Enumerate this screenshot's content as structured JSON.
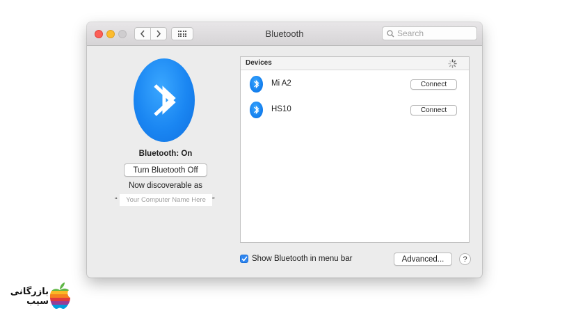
{
  "window": {
    "title": "Bluetooth",
    "search_placeholder": "Search"
  },
  "status": {
    "label": "Bluetooth: On",
    "toggle_button": "Turn Bluetooth Off",
    "discoverable_text": "Now discoverable as",
    "quote_open": "“",
    "quote_close": "”",
    "computer_name": "Your Computer Name Here"
  },
  "devices": {
    "header": "Devices",
    "items": [
      {
        "name": "Mi A2",
        "action": "Connect"
      },
      {
        "name": "HS10",
        "action": "Connect"
      }
    ]
  },
  "footer": {
    "show_in_menu_bar_label": "Show Bluetooth in menu bar",
    "show_in_menu_bar_checked": true,
    "advanced_button": "Advanced...",
    "help_button": "?"
  },
  "watermark": {
    "text_line1": "بازرگانی",
    "text_line2": "سیب"
  },
  "colors": {
    "accent_blue": "#1a86f2",
    "close": "#fc5f57",
    "minimize": "#fdbc2e"
  },
  "icons": [
    "bluetooth-icon",
    "search-icon",
    "chevron-left-icon",
    "chevron-right-icon",
    "grid-icon",
    "spinner-icon",
    "checkmark-icon",
    "apple-logo-icon"
  ]
}
